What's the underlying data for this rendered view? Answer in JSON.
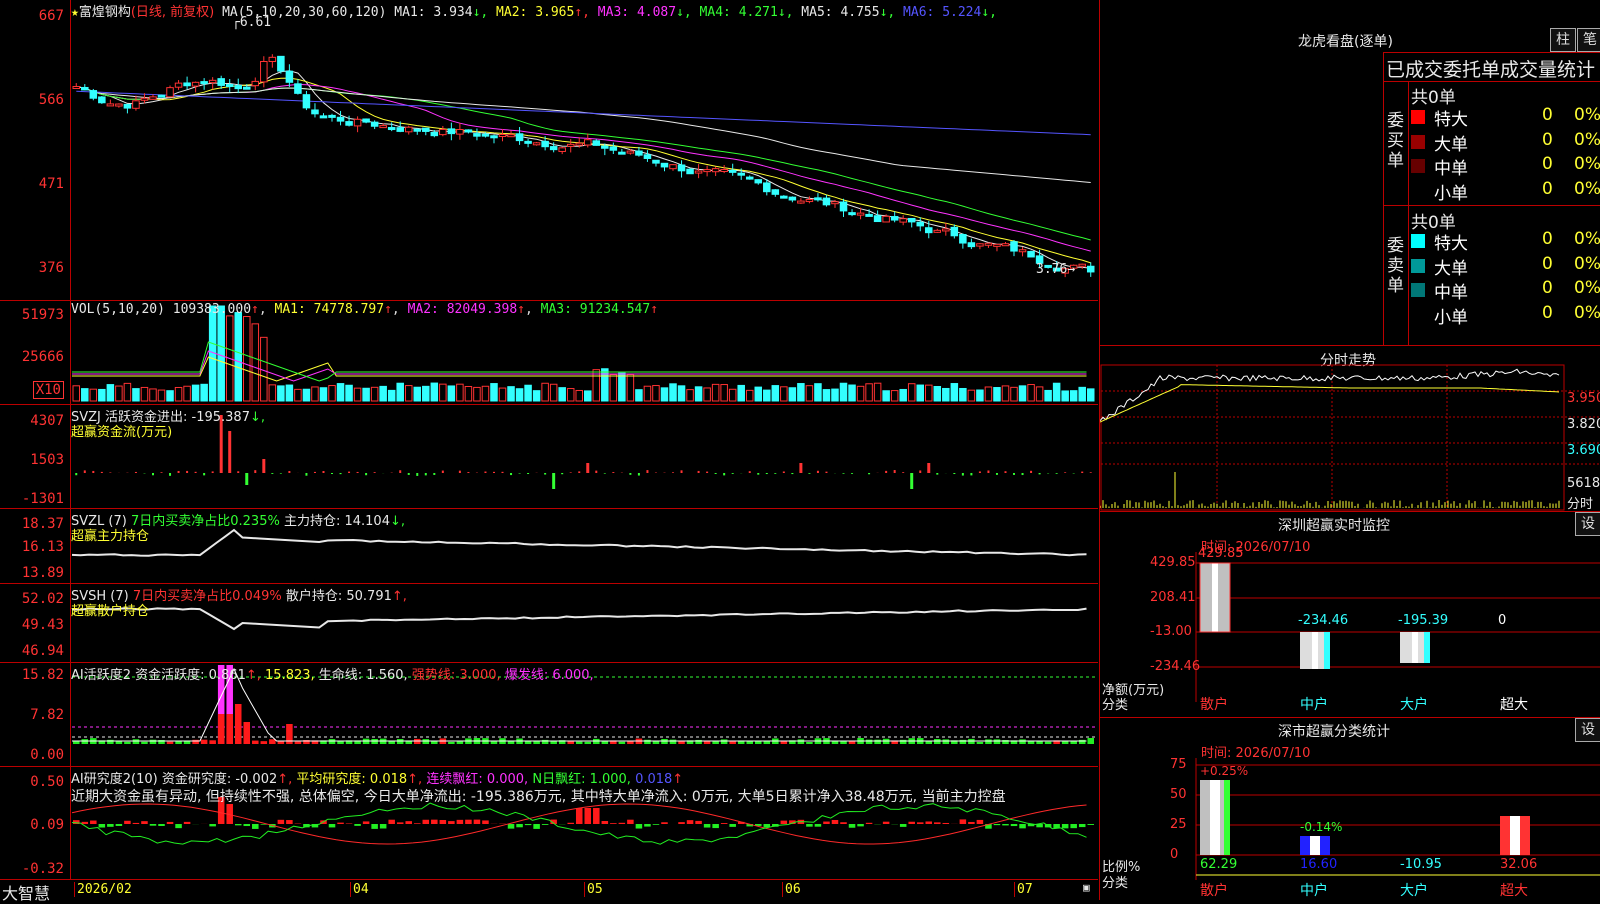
{
  "stock": {
    "star": "★",
    "name": "富煌钢构",
    "mode": "(日线, 前复权)"
  },
  "main_chart": {
    "ticks": [
      "667",
      "566",
      "471",
      "376"
    ],
    "ma_header": "MA(5,10,20,30,60,120)",
    "ma": [
      {
        "label": "MA1:",
        "value": "3.934",
        "arrow": "↓",
        "color": "#e8e8e8"
      },
      {
        "label": "MA2:",
        "value": "3.965",
        "arrow": "↑",
        "color": "#ffff33"
      },
      {
        "label": "MA3:",
        "value": "4.087",
        "arrow": "↓",
        "color": "#ff33ff"
      },
      {
        "label": "MA4:",
        "value": "4.271",
        "arrow": "↓",
        "color": "#33ff33"
      },
      {
        "label": "MA5:",
        "value": "4.755",
        "arrow": "↓",
        "color": "#e8e8e8"
      },
      {
        "label": "MA6:",
        "value": "5.224",
        "arrow": "↓",
        "color": "#5555ff"
      }
    ],
    "high_note": "6.61",
    "low_note": "3.76"
  },
  "vol": {
    "ticks": [
      "51973",
      "25666"
    ],
    "unit": "X10",
    "header": "VOL(5,10,20)",
    "value": "109383.000",
    "ma1": "MA1: 74778.797",
    "ma2": "MA2: 82049.398",
    "ma3": "MA3: 91234.547"
  },
  "svzj": {
    "ticks": [
      "4307",
      "1503",
      "-1301"
    ],
    "header": "SVZJ  活跃资金进出: -195.387",
    "arrow": "↓,",
    "sub": "超赢资金流(万元)"
  },
  "svzl": {
    "ticks": [
      "18.37",
      "16.13",
      "13.89"
    ],
    "header": "SVZL (7)",
    "green_txt": "7日内买卖净占比0.235%",
    "hold": "主力持仓: 14.104",
    "arrow": "↓,",
    "sub": "超赢主力持仓"
  },
  "svsh": {
    "ticks": [
      "52.02",
      "49.43",
      "46.94"
    ],
    "header": "SVSH (7)",
    "red_txt": "7日内买卖净占比0.049%",
    "hold": "散户持仓: 50.791",
    "arrow": "↑,",
    "sub": "超赢散户持仓"
  },
  "ai1": {
    "ticks": [
      "15.82",
      "7.82",
      "0.00"
    ],
    "header": "AI活跃度2 资金活跃度: 0.861",
    "a": "↑,",
    "v2": "15.823,",
    "v3": "生命线: 1.560,",
    "v4": "强势线: 3.000,",
    "v5": "爆发线: 6.000,"
  },
  "ai2": {
    "ticks": [
      "0.50",
      "0.09",
      "-0.32"
    ],
    "header": "AI研究度2(10) 资金研究度: -0.002",
    "a": "↑,",
    "v2": "平均研究度: 0.018",
    "a2": "↑,",
    "v3": "连续飘红: 0.000,",
    "v4": "N日飘红: 1.000,",
    "v5": "0.018",
    "a5": "↑",
    "comment": "近期大资金虽有异动, 但持续性不强, 总体偏空, 今日大单净流出: -195.386万元, 其中特大单净流入: 0万元, 大单5日累计净入38.48万元, 当前主力控盘"
  },
  "dates": [
    "2026/02",
    "04",
    "05",
    "06",
    "07"
  ],
  "footer_logo": "大智慧",
  "right": {
    "dragon_title": "龙虎看盘(逐单)",
    "btn1": "柱",
    "btn2": "笔",
    "stat_title": "已成交委托单成交量统计",
    "buy": {
      "side": "委买单",
      "total": "共0单",
      "rows": [
        {
          "n": "特大",
          "v": "0",
          "p": "0%",
          "c": "#ff0000"
        },
        {
          "n": "大单",
          "v": "0",
          "p": "0%",
          "c": "#990000"
        },
        {
          "n": "中单",
          "v": "0",
          "p": "0%",
          "c": "#660000"
        },
        {
          "n": "小单",
          "v": "0",
          "p": "0%",
          "c": "#000000"
        }
      ]
    },
    "sell": {
      "side": "委卖单",
      "total": "共0单",
      "rows": [
        {
          "n": "特大",
          "v": "0",
          "p": "0%",
          "c": "#00ffff"
        },
        {
          "n": "大单",
          "v": "0",
          "p": "0%",
          "c": "#009999"
        },
        {
          "n": "中单",
          "v": "0",
          "p": "0%",
          "c": "#007777"
        },
        {
          "n": "小单",
          "v": "0",
          "p": "0%",
          "c": "#000000"
        }
      ]
    },
    "intraday": {
      "title": "分时走势",
      "p1": "3.950",
      "p2": "3.820",
      "p3": "3.690",
      "vol": "5618",
      "vol_unit": "分时"
    },
    "monitor": {
      "title": "深圳超赢实时监控",
      "btn": "设",
      "time": "时间: 2026/07/10",
      "ticks": [
        "429.85",
        "208.41",
        "-13.00",
        "-234.46"
      ],
      "ylabel": "净额(万元)",
      "xlabel": "分类",
      "bars": [
        {
          "cat": "散户",
          "val": "429.85"
        },
        {
          "cat": "中户",
          "val": "-234.46"
        },
        {
          "cat": "大户",
          "val": "-195.39"
        },
        {
          "cat": "超大",
          "val": "0"
        }
      ]
    },
    "classify": {
      "title": "深市超赢分类统计",
      "btn": "设",
      "time": "时间: 2026/07/10",
      "ticks": [
        "75",
        "50",
        "25",
        "0"
      ],
      "ylabel": "比例%",
      "xlabel": "分类",
      "top": [
        {
          "v": "+0.25%"
        },
        {
          "v": "-0.14%"
        }
      ],
      "bars": [
        {
          "cat": "散户",
          "val": "62.29"
        },
        {
          "cat": "中户",
          "val": "16.60"
        },
        {
          "cat": "大户",
          "val": "-10.95"
        },
        {
          "cat": "超大",
          "val": "32.06"
        }
      ]
    }
  }
}
